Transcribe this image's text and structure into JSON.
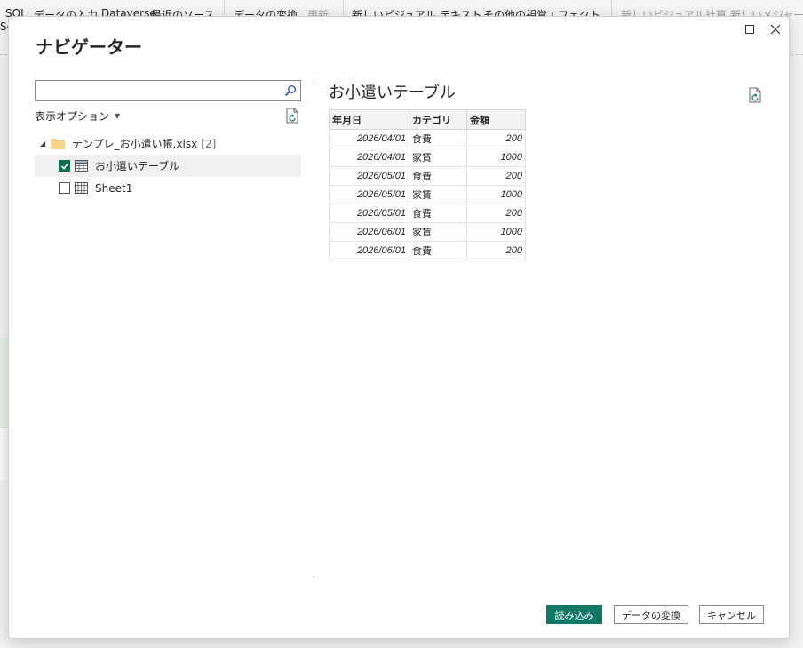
{
  "ribbon": {
    "items": [
      {
        "label": "SQL"
      },
      {
        "label": "データの入力"
      },
      {
        "label": "Dataverse"
      },
      {
        "label": "最近のソース"
      },
      {
        "label": "データの変換"
      },
      {
        "label": "更新"
      },
      {
        "label": "新しいビジュアル"
      },
      {
        "label": "テキスト"
      },
      {
        "label": "その他の視覚エフェクト"
      },
      {
        "label": "新しいビジュアル計算"
      },
      {
        "label": "新しいメジャー"
      }
    ],
    "second_line": "Se"
  },
  "dialog": {
    "title": "ナビゲーター"
  },
  "left_pane": {
    "search_value": "",
    "display_options_label": "表示オプション",
    "tree": {
      "file_name": "テンプレ_お小遣い帳.xlsx",
      "file_count": "[2]",
      "items": [
        {
          "label": "お小遣いテーブル",
          "checked": true,
          "selected": true
        },
        {
          "label": "Sheet1",
          "checked": false,
          "selected": false
        }
      ]
    }
  },
  "preview": {
    "title": "お小遣いテーブル",
    "columns": [
      "年月日",
      "カテゴリ",
      "金額"
    ],
    "rows": [
      [
        "2026/04/01",
        "食費",
        "200"
      ],
      [
        "2026/04/01",
        "家賃",
        "1000"
      ],
      [
        "2026/05/01",
        "食費",
        "200"
      ],
      [
        "2026/05/01",
        "家賃",
        "1000"
      ],
      [
        "2026/05/01",
        "食費",
        "200"
      ],
      [
        "2026/06/01",
        "家賃",
        "1000"
      ],
      [
        "2026/06/01",
        "食費",
        "200"
      ]
    ]
  },
  "footer": {
    "load_label": "読み込み",
    "transform_label": "データの変換",
    "cancel_label": "キャンセル"
  },
  "colors": {
    "accent": "#117865",
    "checkbox": "#0e6b50"
  }
}
